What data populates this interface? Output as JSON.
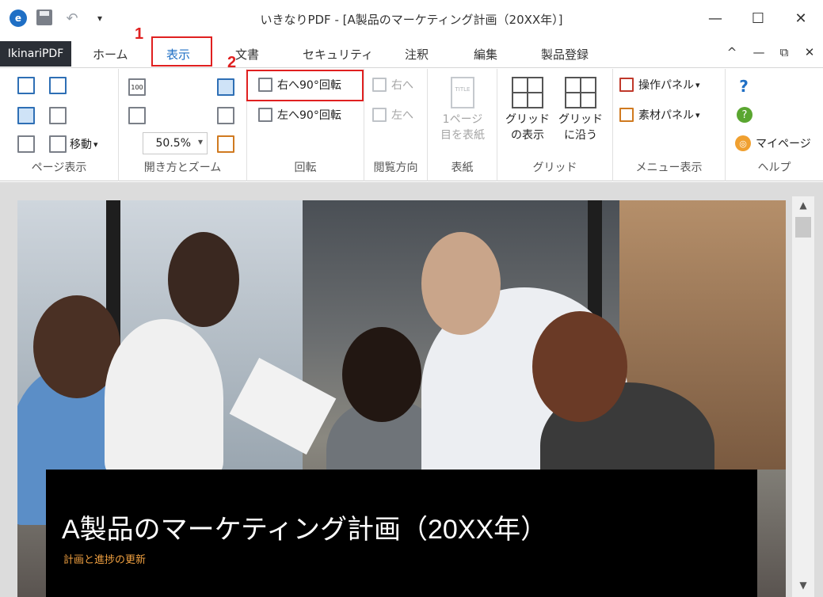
{
  "window": {
    "title": "いきなりPDF - [A製品のマーケティング計画（20XX年）]",
    "app_logo": "e",
    "minimize": "—",
    "maximize": "☐",
    "close": "✕"
  },
  "tabs": {
    "app_menu": "IkinariPDF",
    "items": [
      "ホーム",
      "表示",
      "文書",
      "セキュリティ",
      "注釈",
      "編集",
      "製品登録"
    ],
    "active": "表示",
    "ribbon_controls": [
      "^",
      "—",
      "⧉",
      "✕"
    ]
  },
  "callouts": {
    "step1": "1",
    "step2": "2"
  },
  "ribbon": {
    "page_display": {
      "label": "ページ表示",
      "move_label": "移動"
    },
    "open_zoom": {
      "label": "開き方とズーム",
      "zoom_value": "50.5%",
      "hundred_icon_text": "100"
    },
    "rotate": {
      "label": "回転",
      "rotate_right": "右へ90°回転",
      "rotate_left": "左へ90°回転"
    },
    "reading_direction": {
      "label": "閲覧方向",
      "right": "右へ",
      "left": "左へ"
    },
    "cover": {
      "label": "表紙",
      "first_page_line1": "1ページ",
      "first_page_line2": "目を表紙",
      "icon_text": "TITLE"
    },
    "grid": {
      "label": "グリッド",
      "show_line1": "グリッド",
      "show_line2": "の表示",
      "snap_line1": "グリッド",
      "snap_line2": "に沿う"
    },
    "menu_display": {
      "label": "メニュー表示",
      "operation_panel": "操作パネル",
      "material_panel": "素材パネル"
    },
    "help": {
      "label": "ヘルプ",
      "help_icon_text": "?",
      "mypage": "マイページ"
    }
  },
  "document": {
    "title": "A製品のマーケティング計画（20XX年）",
    "subtitle": "計画と進捗の更新"
  },
  "colors": {
    "accent": "#1f6fc5",
    "callout_red": "#e02020",
    "subtitle_orange": "#f0a040",
    "app_tab_bg": "#2b2f36"
  }
}
